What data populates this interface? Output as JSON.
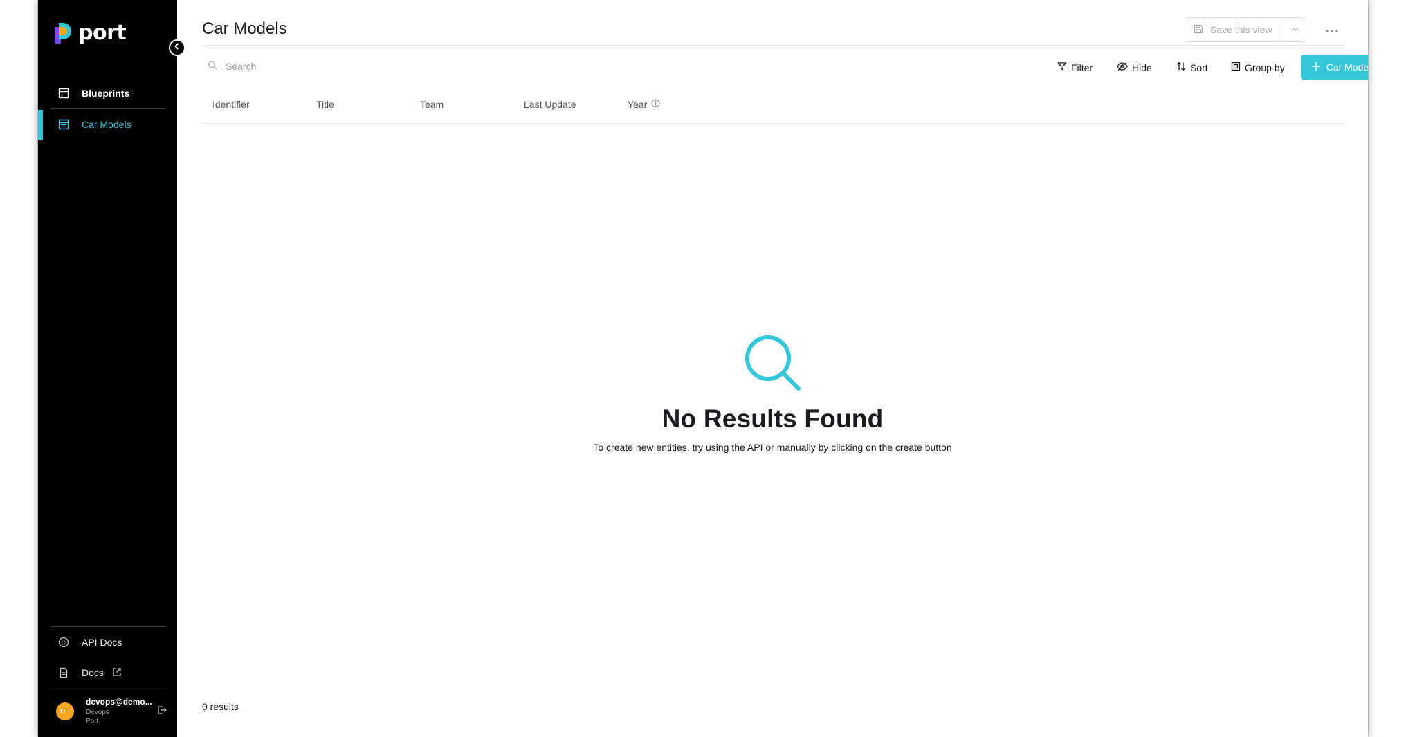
{
  "app": {
    "logo_text": "port"
  },
  "sidebar": {
    "items": [
      {
        "label": "Blueprints",
        "icon": "blueprint-icon",
        "active": false
      },
      {
        "label": "Car Models",
        "icon": "table-icon",
        "active": true
      }
    ],
    "bottom_items": [
      {
        "label": "API Docs",
        "icon": "api-icon"
      },
      {
        "label": "Docs",
        "icon": "document-icon"
      }
    ],
    "user": {
      "initials": "DE",
      "email": "devops@demo...",
      "team": "Devops",
      "org": "Port"
    }
  },
  "header": {
    "title": "Car Models",
    "save_view_label": "Save this view"
  },
  "search": {
    "placeholder": "Search"
  },
  "toolbar": {
    "filter_label": "Filter",
    "hide_label": "Hide",
    "sort_label": "Sort",
    "group_by_label": "Group by",
    "create_label": "Car Model"
  },
  "table": {
    "columns": [
      "Identifier",
      "Title",
      "Team",
      "Last Update",
      "Year"
    ],
    "rows": []
  },
  "empty_state": {
    "title": "No Results Found",
    "subtitle": "To create new entities, try using the API or manually by clicking on the create button"
  },
  "footer": {
    "results_text": "0 results"
  },
  "colors": {
    "accent": "#35c7d9",
    "sidebar_bg": "#000000",
    "annotation_arrow": "#e8331d",
    "avatar": "#f5a623"
  }
}
